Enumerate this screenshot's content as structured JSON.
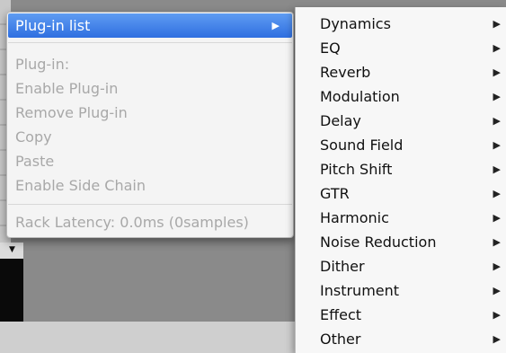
{
  "context_menu": {
    "items": [
      {
        "label": "Plug-in list",
        "arrow": "▶"
      },
      {
        "label": "Plug-in:"
      },
      {
        "label": "Enable Plug-in"
      },
      {
        "label": "Remove Plug-in"
      },
      {
        "label": "Copy"
      },
      {
        "label": "Paste"
      },
      {
        "label": "Enable Side Chain"
      },
      {
        "label": "Rack Latency: 0.0ms (0samples)"
      }
    ]
  },
  "submenu": {
    "arrow": "▶",
    "items": [
      {
        "label": "Dynamics"
      },
      {
        "label": "EQ"
      },
      {
        "label": "Reverb"
      },
      {
        "label": "Modulation"
      },
      {
        "label": "Delay"
      },
      {
        "label": "Sound Field"
      },
      {
        "label": "Pitch Shift"
      },
      {
        "label": "GTR"
      },
      {
        "label": "Harmonic"
      },
      {
        "label": "Noise Reduction"
      },
      {
        "label": "Dither"
      },
      {
        "label": "Instrument"
      },
      {
        "label": "Effect"
      },
      {
        "label": "Other"
      }
    ]
  },
  "background": {
    "dropdown_arrow": "▼"
  },
  "colors": {
    "highlight": "#2f6fe0",
    "disabled_text": "#a8a8a8",
    "enabled_text": "#111111"
  }
}
